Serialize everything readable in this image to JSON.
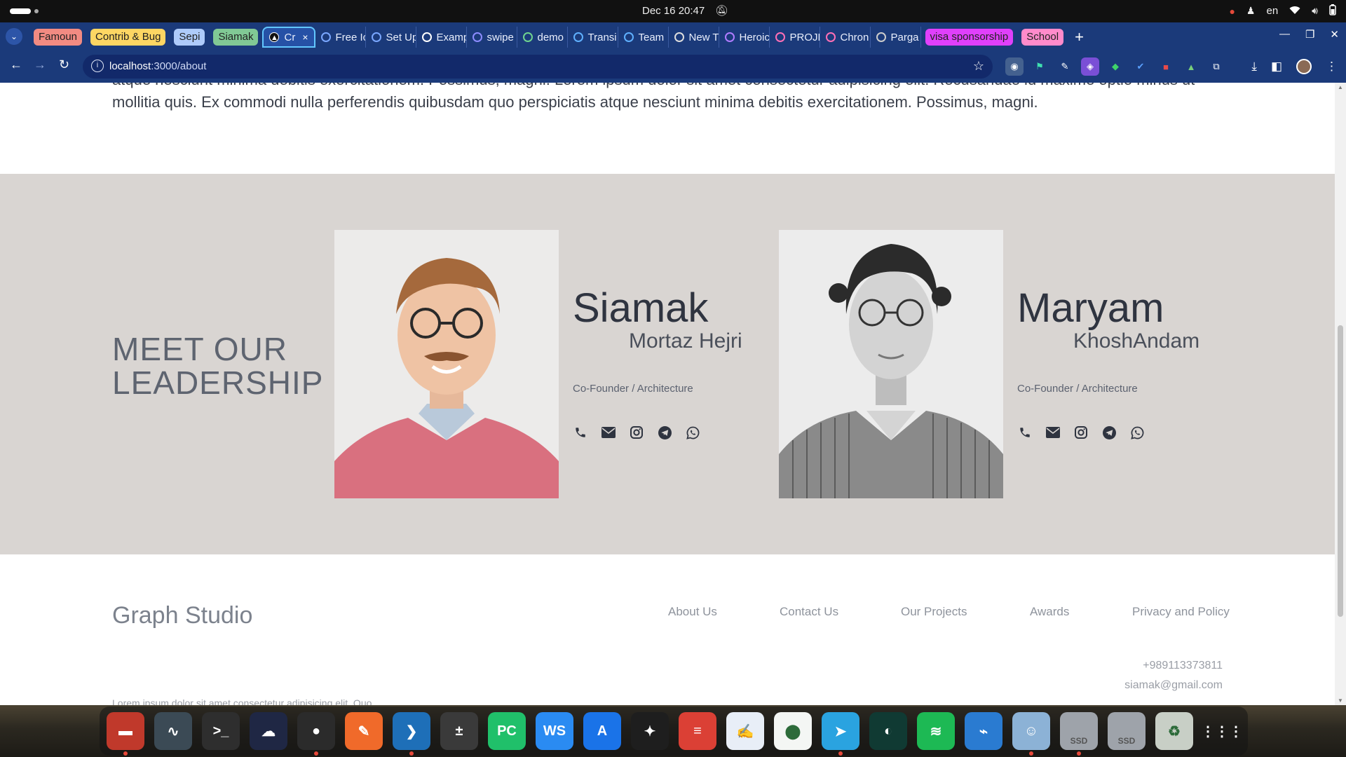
{
  "system": {
    "clock": "Dec 16  20:47",
    "lang": "en"
  },
  "browser": {
    "tab_groups": [
      {
        "label": "Famoun",
        "color": "#f28b82"
      },
      {
        "label": "Contrib & Bug",
        "color": "#fdd663"
      },
      {
        "label": "Sepi",
        "color": "#aecbfa"
      },
      {
        "label": "Siamak",
        "color": "#81c995"
      }
    ],
    "active_tab": {
      "label": "Cr",
      "close": "×"
    },
    "tabs": [
      "Free Ic",
      "Set Up",
      "Examp",
      "swipe",
      "demo",
      "Transi",
      "Team",
      "New T",
      "Heroic",
      "PROJE",
      "Chron",
      "Parga"
    ],
    "end_groups": [
      {
        "label": "visa sponsorship",
        "color": "#e040fb"
      },
      {
        "label": "School",
        "color": "#ff8bcb"
      }
    ],
    "url_host": "localhost",
    "url_path": ":3000/about"
  },
  "page": {
    "intro_text": "atque nesciunt minima debitis exercitationem. Possimus, magni. Lorem ipsum dolor sit amet consectetur adipisicing elit. Recusandae id maxime optio minus ut mollitia quis. Ex commodi nulla perferendis quibusdam quo perspiciatis atque nesciunt minima debitis exercitationem. Possimus, magni.",
    "section_title_line1": "MEET OUR",
    "section_title_line2": "LEADERSHIP",
    "leaders": [
      {
        "first": "Siamak",
        "last": "Mortaz Hejri",
        "role": "Co-Founder / Architecture"
      },
      {
        "first": "Maryam",
        "last": "KhoshAndam",
        "role": "Co-Founder / Architecture"
      }
    ],
    "contact_icons": [
      "phone-icon",
      "email-icon",
      "instagram-icon",
      "telegram-icon",
      "whatsapp-icon"
    ]
  },
  "footer": {
    "brand": "Graph Studio",
    "nav": [
      "About Us",
      "Contact Us",
      "Our Projects",
      "Awards",
      "Privacy and Policy"
    ],
    "phone": "+989113373811",
    "email": "siamak@gmail.com",
    "tagline": "Lorem ipsum dolor sit amet consectetur adipisicing elit. Quo."
  },
  "dock": {
    "apps": [
      {
        "name": "files",
        "color": "#c0392b",
        "glyph": "▬"
      },
      {
        "name": "system-monitor",
        "color": "#3b4a55",
        "glyph": "∿"
      },
      {
        "name": "terminal",
        "color": "#2e2e2e",
        "glyph": ">_"
      },
      {
        "name": "cloud-app",
        "color": "#1f2744",
        "glyph": "☁"
      },
      {
        "name": "chrome",
        "color": "#2b2b2b",
        "glyph": "●"
      },
      {
        "name": "paint-app",
        "color": "#f06a2a",
        "glyph": "✎"
      },
      {
        "name": "vscode",
        "color": "#1e6fb8",
        "glyph": "❯"
      },
      {
        "name": "calculator",
        "color": "#3a3a3a",
        "glyph": "±"
      },
      {
        "name": "pycharm",
        "color": "#20c06a",
        "glyph": "PC"
      },
      {
        "name": "webstorm",
        "color": "#2a8bf2",
        "glyph": "WS"
      },
      {
        "name": "app-store",
        "color": "#1a73e8",
        "glyph": "A"
      },
      {
        "name": "figma",
        "color": "#1e1e1e",
        "glyph": "✦"
      },
      {
        "name": "todoist",
        "color": "#db4035",
        "glyph": "≡"
      },
      {
        "name": "text-editor",
        "color": "#e8eef7",
        "glyph": "✍"
      },
      {
        "name": "mongodb",
        "color": "#f4f6f4",
        "glyph": "⬤"
      },
      {
        "name": "telegram",
        "color": "#2aa3e0",
        "glyph": "➤"
      },
      {
        "name": "dbeaver",
        "color": "#103a33",
        "glyph": "◐"
      },
      {
        "name": "spotify",
        "color": "#1db954",
        "glyph": "≋"
      },
      {
        "name": "monitor-app",
        "color": "#2a7bd1",
        "glyph": "⌁"
      },
      {
        "name": "anime-app",
        "color": "#8cb2d6",
        "glyph": "☺"
      },
      {
        "name": "ssd-drive-1",
        "color": "#9ea3aa",
        "glyph": "SSD"
      },
      {
        "name": "ssd-drive-2",
        "color": "#9ea3aa",
        "glyph": "SSD"
      },
      {
        "name": "trash",
        "color": "#c8cfc6",
        "glyph": "♻"
      },
      {
        "name": "app-grid",
        "color": "transparent",
        "glyph": "⋮⋮⋮"
      }
    ]
  }
}
